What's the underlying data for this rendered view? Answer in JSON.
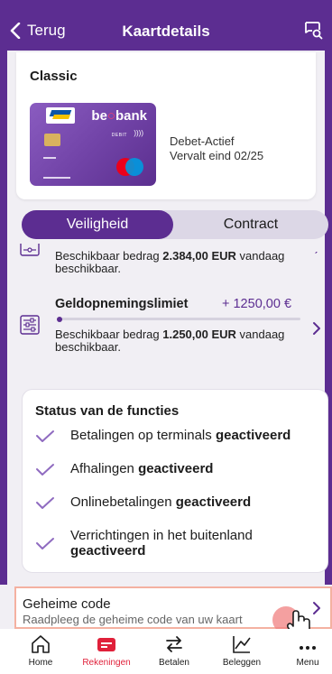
{
  "header": {
    "back_label": "Terug",
    "title": "Kaartdetails"
  },
  "card": {
    "name": "Classic",
    "brand": "beobank",
    "card_type": "DEBIT",
    "status": "Debet-Actief",
    "expiry": "Vervalt eind 02/25"
  },
  "tabs": [
    {
      "label": "Veiligheid",
      "active": true
    },
    {
      "label": "Contract",
      "active": false
    }
  ],
  "limits": [
    {
      "description_prefix": "Beschikbaar bedrag ",
      "amount": "2.384,00 EUR",
      "description_suffix": " vandaag beschikbaar."
    },
    {
      "title": "Geldopnemingslimiet",
      "value": "+ 1250,00 €",
      "description_prefix": "Beschikbaar bedrag ",
      "amount": "1.250,00 EUR",
      "description_suffix": " vandaag beschikbaar."
    }
  ],
  "status_functions": {
    "title": "Status van de functies",
    "items": [
      {
        "label": "Betalingen op terminals ",
        "state": "geactiveerd"
      },
      {
        "label": "Afhalingen ",
        "state": "geactiveerd"
      },
      {
        "label": "Onlinebetalingen ",
        "state": "geactiveerd"
      },
      {
        "label": "Verrichtingen in het buitenland ",
        "state": "geactiveerd"
      }
    ]
  },
  "secret_code": {
    "title": "Geheime code",
    "subtitle": "Raadpleeg de geheime code van uw kaart"
  },
  "nav": [
    {
      "label": "Home",
      "icon": "home-icon",
      "active": false
    },
    {
      "label": "Rekeningen",
      "icon": "card-icon",
      "active": true
    },
    {
      "label": "Betalen",
      "icon": "transfer-icon",
      "active": false
    },
    {
      "label": "Beleggen",
      "icon": "chart-icon",
      "active": false
    },
    {
      "label": "Menu",
      "icon": "more-icon",
      "active": false
    }
  ],
  "colors": {
    "brand_purple": "#5c2d91",
    "active_red": "#e0203a",
    "highlight_border": "#f4b1a1"
  }
}
